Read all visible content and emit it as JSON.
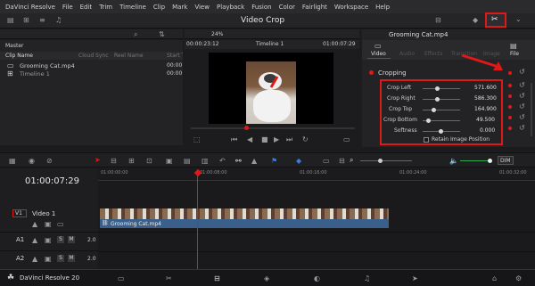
{
  "menu": [
    "DaVinci Resolve",
    "File",
    "Edit",
    "Trim",
    "Timeline",
    "Clip",
    "Mark",
    "View",
    "Playback",
    "Fusion",
    "Color",
    "Fairlight",
    "Workspace",
    "Help"
  ],
  "window_title": "Video Crop",
  "media_pool": {
    "tab": "Master",
    "columns": [
      "Clip Name",
      "Cloud Sync",
      "Reel Name",
      "Start TC"
    ],
    "items": [
      {
        "name": "Grooming Cat.mp4",
        "tc": "00:00"
      },
      {
        "name": "Timeline 1",
        "tc": "00:00"
      }
    ]
  },
  "viewer": {
    "zoom": "24%",
    "timecode_left": "00:00:23:12",
    "timeline_name": "Timeline 1",
    "timecode_right": "01:00:07:29"
  },
  "inspector": {
    "clip_name": "Grooming Cat.mp4",
    "tabs": [
      "Video",
      "Audio",
      "Effects",
      "Transition",
      "Image",
      "File"
    ],
    "section": "Cropping",
    "params": [
      {
        "label": "Crop Left",
        "value": "571.600"
      },
      {
        "label": "Crop Right",
        "value": "586.300"
      },
      {
        "label": "Crop Top",
        "value": "164.900"
      },
      {
        "label": "Crop Bottom",
        "value": "49.500"
      },
      {
        "label": "Softness",
        "value": "0.000"
      }
    ],
    "retain_label": "Retain Image Position"
  },
  "timeline": {
    "timecode": "01:00:07:29",
    "ruler": [
      "01:00:00:00",
      "01:00:08:00",
      "01:00:16:00",
      "01:00:24:00",
      "01:00:32:00"
    ],
    "tracks": [
      {
        "id": "V1",
        "name": "Video 1"
      },
      {
        "id": "A1",
        "vol": "2.0"
      },
      {
        "id": "A2",
        "vol": "2.0"
      }
    ],
    "audio_clip": "Grooming Cat.mp4",
    "dim": "DIM"
  },
  "footer": {
    "app": "DaVinci Resolve 20"
  },
  "colors": {
    "highlight": "#e01818",
    "playhead": "#e01818"
  }
}
